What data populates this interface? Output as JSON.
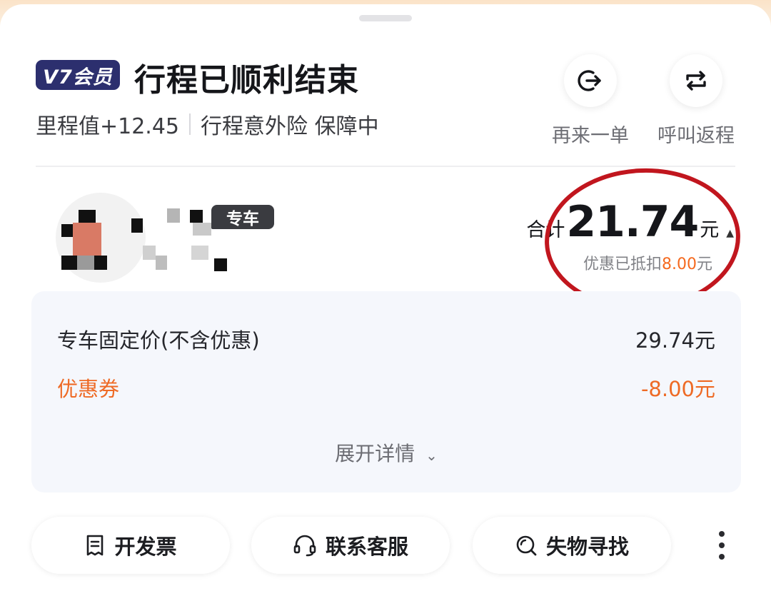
{
  "header": {
    "member_badge": "V7会员",
    "title": "行程已顺利结束",
    "mileage": "里程值+12.45",
    "insurance": "行程意外险 保障中"
  },
  "actions": [
    {
      "label": "再来一单",
      "icon": "reorder-arrow-icon"
    },
    {
      "label": "呼叫返程",
      "icon": "return-trip-icon"
    }
  ],
  "driver": {
    "car_type_tag": "专车"
  },
  "total": {
    "prefix": "合计",
    "amount": "21.74",
    "suffix": "元",
    "discount_prefix": "优惠已抵扣",
    "discount_amount": "8.00",
    "discount_suffix": "元"
  },
  "details": {
    "rows": [
      {
        "label": "专车固定价(不含优惠)",
        "value": "29.74元"
      },
      {
        "label": "优惠券",
        "value": "-8.00元"
      }
    ],
    "expand_label": "展开详情"
  },
  "bottom_buttons": [
    {
      "label": "开发票",
      "icon": "invoice-icon"
    },
    {
      "label": "联系客服",
      "icon": "headset-icon"
    },
    {
      "label": "失物寻找",
      "icon": "lost-found-icon"
    }
  ],
  "colors": {
    "accent_orange": "#ee6a25",
    "badge_navy": "#2c2f6e",
    "highlight_ring": "#c1161e"
  }
}
